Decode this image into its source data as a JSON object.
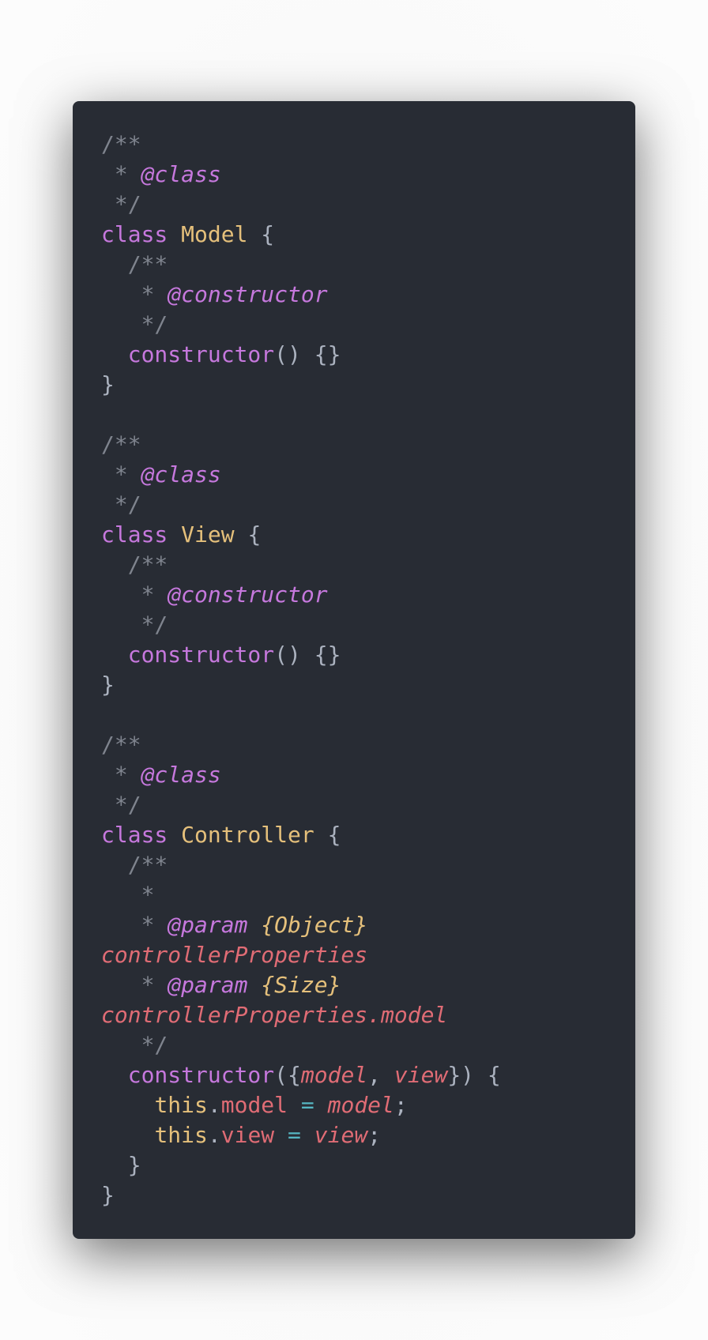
{
  "colors": {
    "background": "#282c34",
    "comment": "#7f848e",
    "doc_tag": "#c678dd",
    "doc_type": "#e5c07b",
    "doc_name": "#e06c75",
    "keyword": "#c678dd",
    "class_name": "#e5c07b",
    "punctuation": "#abb2bf",
    "parameter": "#e06c75",
    "this": "#e5c07b",
    "property": "#e06c75",
    "operator": "#56b6c2"
  },
  "code": {
    "lines": [
      [
        {
          "t": "/**",
          "k": "comment"
        }
      ],
      [
        {
          "t": " * ",
          "k": "comment"
        },
        {
          "t": "@class",
          "k": "doctag"
        }
      ],
      [
        {
          "t": " */",
          "k": "comment"
        }
      ],
      [
        {
          "t": "class",
          "k": "keyword"
        },
        {
          "t": " ",
          "k": "plain"
        },
        {
          "t": "Model",
          "k": "classname"
        },
        {
          "t": " {",
          "k": "punct"
        }
      ],
      [
        {
          "t": "  /**",
          "k": "comment"
        }
      ],
      [
        {
          "t": "   * ",
          "k": "comment"
        },
        {
          "t": "@constructor",
          "k": "doctag"
        }
      ],
      [
        {
          "t": "   */",
          "k": "comment"
        }
      ],
      [
        {
          "t": "  ",
          "k": "plain"
        },
        {
          "t": "constructor",
          "k": "func"
        },
        {
          "t": "() {}",
          "k": "punct"
        }
      ],
      [
        {
          "t": "}",
          "k": "punct"
        }
      ],
      [],
      [
        {
          "t": "/**",
          "k": "comment"
        }
      ],
      [
        {
          "t": " * ",
          "k": "comment"
        },
        {
          "t": "@class",
          "k": "doctag"
        }
      ],
      [
        {
          "t": " */",
          "k": "comment"
        }
      ],
      [
        {
          "t": "class",
          "k": "keyword"
        },
        {
          "t": " ",
          "k": "plain"
        },
        {
          "t": "View",
          "k": "classname"
        },
        {
          "t": " {",
          "k": "punct"
        }
      ],
      [
        {
          "t": "  /**",
          "k": "comment"
        }
      ],
      [
        {
          "t": "   * ",
          "k": "comment"
        },
        {
          "t": "@constructor",
          "k": "doctag"
        }
      ],
      [
        {
          "t": "   */",
          "k": "comment"
        }
      ],
      [
        {
          "t": "  ",
          "k": "plain"
        },
        {
          "t": "constructor",
          "k": "func"
        },
        {
          "t": "() {}",
          "k": "punct"
        }
      ],
      [
        {
          "t": "}",
          "k": "punct"
        }
      ],
      [],
      [
        {
          "t": "/**",
          "k": "comment"
        }
      ],
      [
        {
          "t": " * ",
          "k": "comment"
        },
        {
          "t": "@class",
          "k": "doctag"
        }
      ],
      [
        {
          "t": " */",
          "k": "comment"
        }
      ],
      [
        {
          "t": "class",
          "k": "keyword"
        },
        {
          "t": " ",
          "k": "plain"
        },
        {
          "t": "Controller",
          "k": "classname"
        },
        {
          "t": " {",
          "k": "punct"
        }
      ],
      [
        {
          "t": "  /**",
          "k": "comment"
        }
      ],
      [
        {
          "t": "   *",
          "k": "comment"
        }
      ],
      [
        {
          "t": "   * ",
          "k": "comment"
        },
        {
          "t": "@param",
          "k": "doctag"
        },
        {
          "t": " ",
          "k": "comment"
        },
        {
          "t": "{Object}",
          "k": "doctype"
        }
      ],
      [
        {
          "t": "controllerProperties",
          "k": "docname"
        }
      ],
      [
        {
          "t": "   * ",
          "k": "comment"
        },
        {
          "t": "@param",
          "k": "doctag"
        },
        {
          "t": " ",
          "k": "comment"
        },
        {
          "t": "{Size}",
          "k": "doctype"
        }
      ],
      [
        {
          "t": "controllerProperties.model",
          "k": "docname"
        }
      ],
      [
        {
          "t": "   */",
          "k": "comment"
        }
      ],
      [
        {
          "t": "  ",
          "k": "plain"
        },
        {
          "t": "constructor",
          "k": "func"
        },
        {
          "t": "({",
          "k": "punct"
        },
        {
          "t": "model",
          "k": "param"
        },
        {
          "t": ", ",
          "k": "punct"
        },
        {
          "t": "view",
          "k": "param"
        },
        {
          "t": "}) {",
          "k": "punct"
        }
      ],
      [
        {
          "t": "    ",
          "k": "plain"
        },
        {
          "t": "this",
          "k": "this"
        },
        {
          "t": ".",
          "k": "punct"
        },
        {
          "t": "model",
          "k": "prop"
        },
        {
          "t": " ",
          "k": "plain"
        },
        {
          "t": "=",
          "k": "op"
        },
        {
          "t": " ",
          "k": "plain"
        },
        {
          "t": "model",
          "k": "param"
        },
        {
          "t": ";",
          "k": "punct"
        }
      ],
      [
        {
          "t": "    ",
          "k": "plain"
        },
        {
          "t": "this",
          "k": "this"
        },
        {
          "t": ".",
          "k": "punct"
        },
        {
          "t": "view",
          "k": "prop"
        },
        {
          "t": " ",
          "k": "plain"
        },
        {
          "t": "=",
          "k": "op"
        },
        {
          "t": " ",
          "k": "plain"
        },
        {
          "t": "view",
          "k": "param"
        },
        {
          "t": ";",
          "k": "punct"
        }
      ],
      [
        {
          "t": "  }",
          "k": "punct"
        }
      ],
      [
        {
          "t": "}",
          "k": "punct"
        }
      ]
    ]
  }
}
